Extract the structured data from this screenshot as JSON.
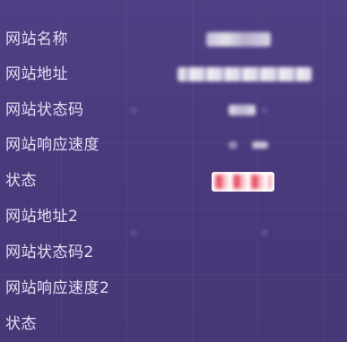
{
  "rows": [
    {
      "label": "网站名称",
      "value_state": "blurred"
    },
    {
      "label": "网站地址",
      "value_state": "blurred"
    },
    {
      "label": "网站状态码",
      "value_state": "blurred"
    },
    {
      "label": "网站响应速度",
      "value_state": "blurred"
    },
    {
      "label": "状态",
      "value_state": "blurred-badge"
    },
    {
      "label": "网站地址2",
      "value_state": "empty"
    },
    {
      "label": "网站状态码2",
      "value_state": "empty"
    },
    {
      "label": "网站响应速度2",
      "value_state": "empty"
    },
    {
      "label": "状态",
      "value_state": "empty"
    }
  ],
  "colors": {
    "background_top": "#4f3f84",
    "background_bottom": "#473776",
    "label_text": "#e3def2",
    "status_badge_bg": "#ffffff",
    "status_badge_accent": "#e8546b"
  }
}
